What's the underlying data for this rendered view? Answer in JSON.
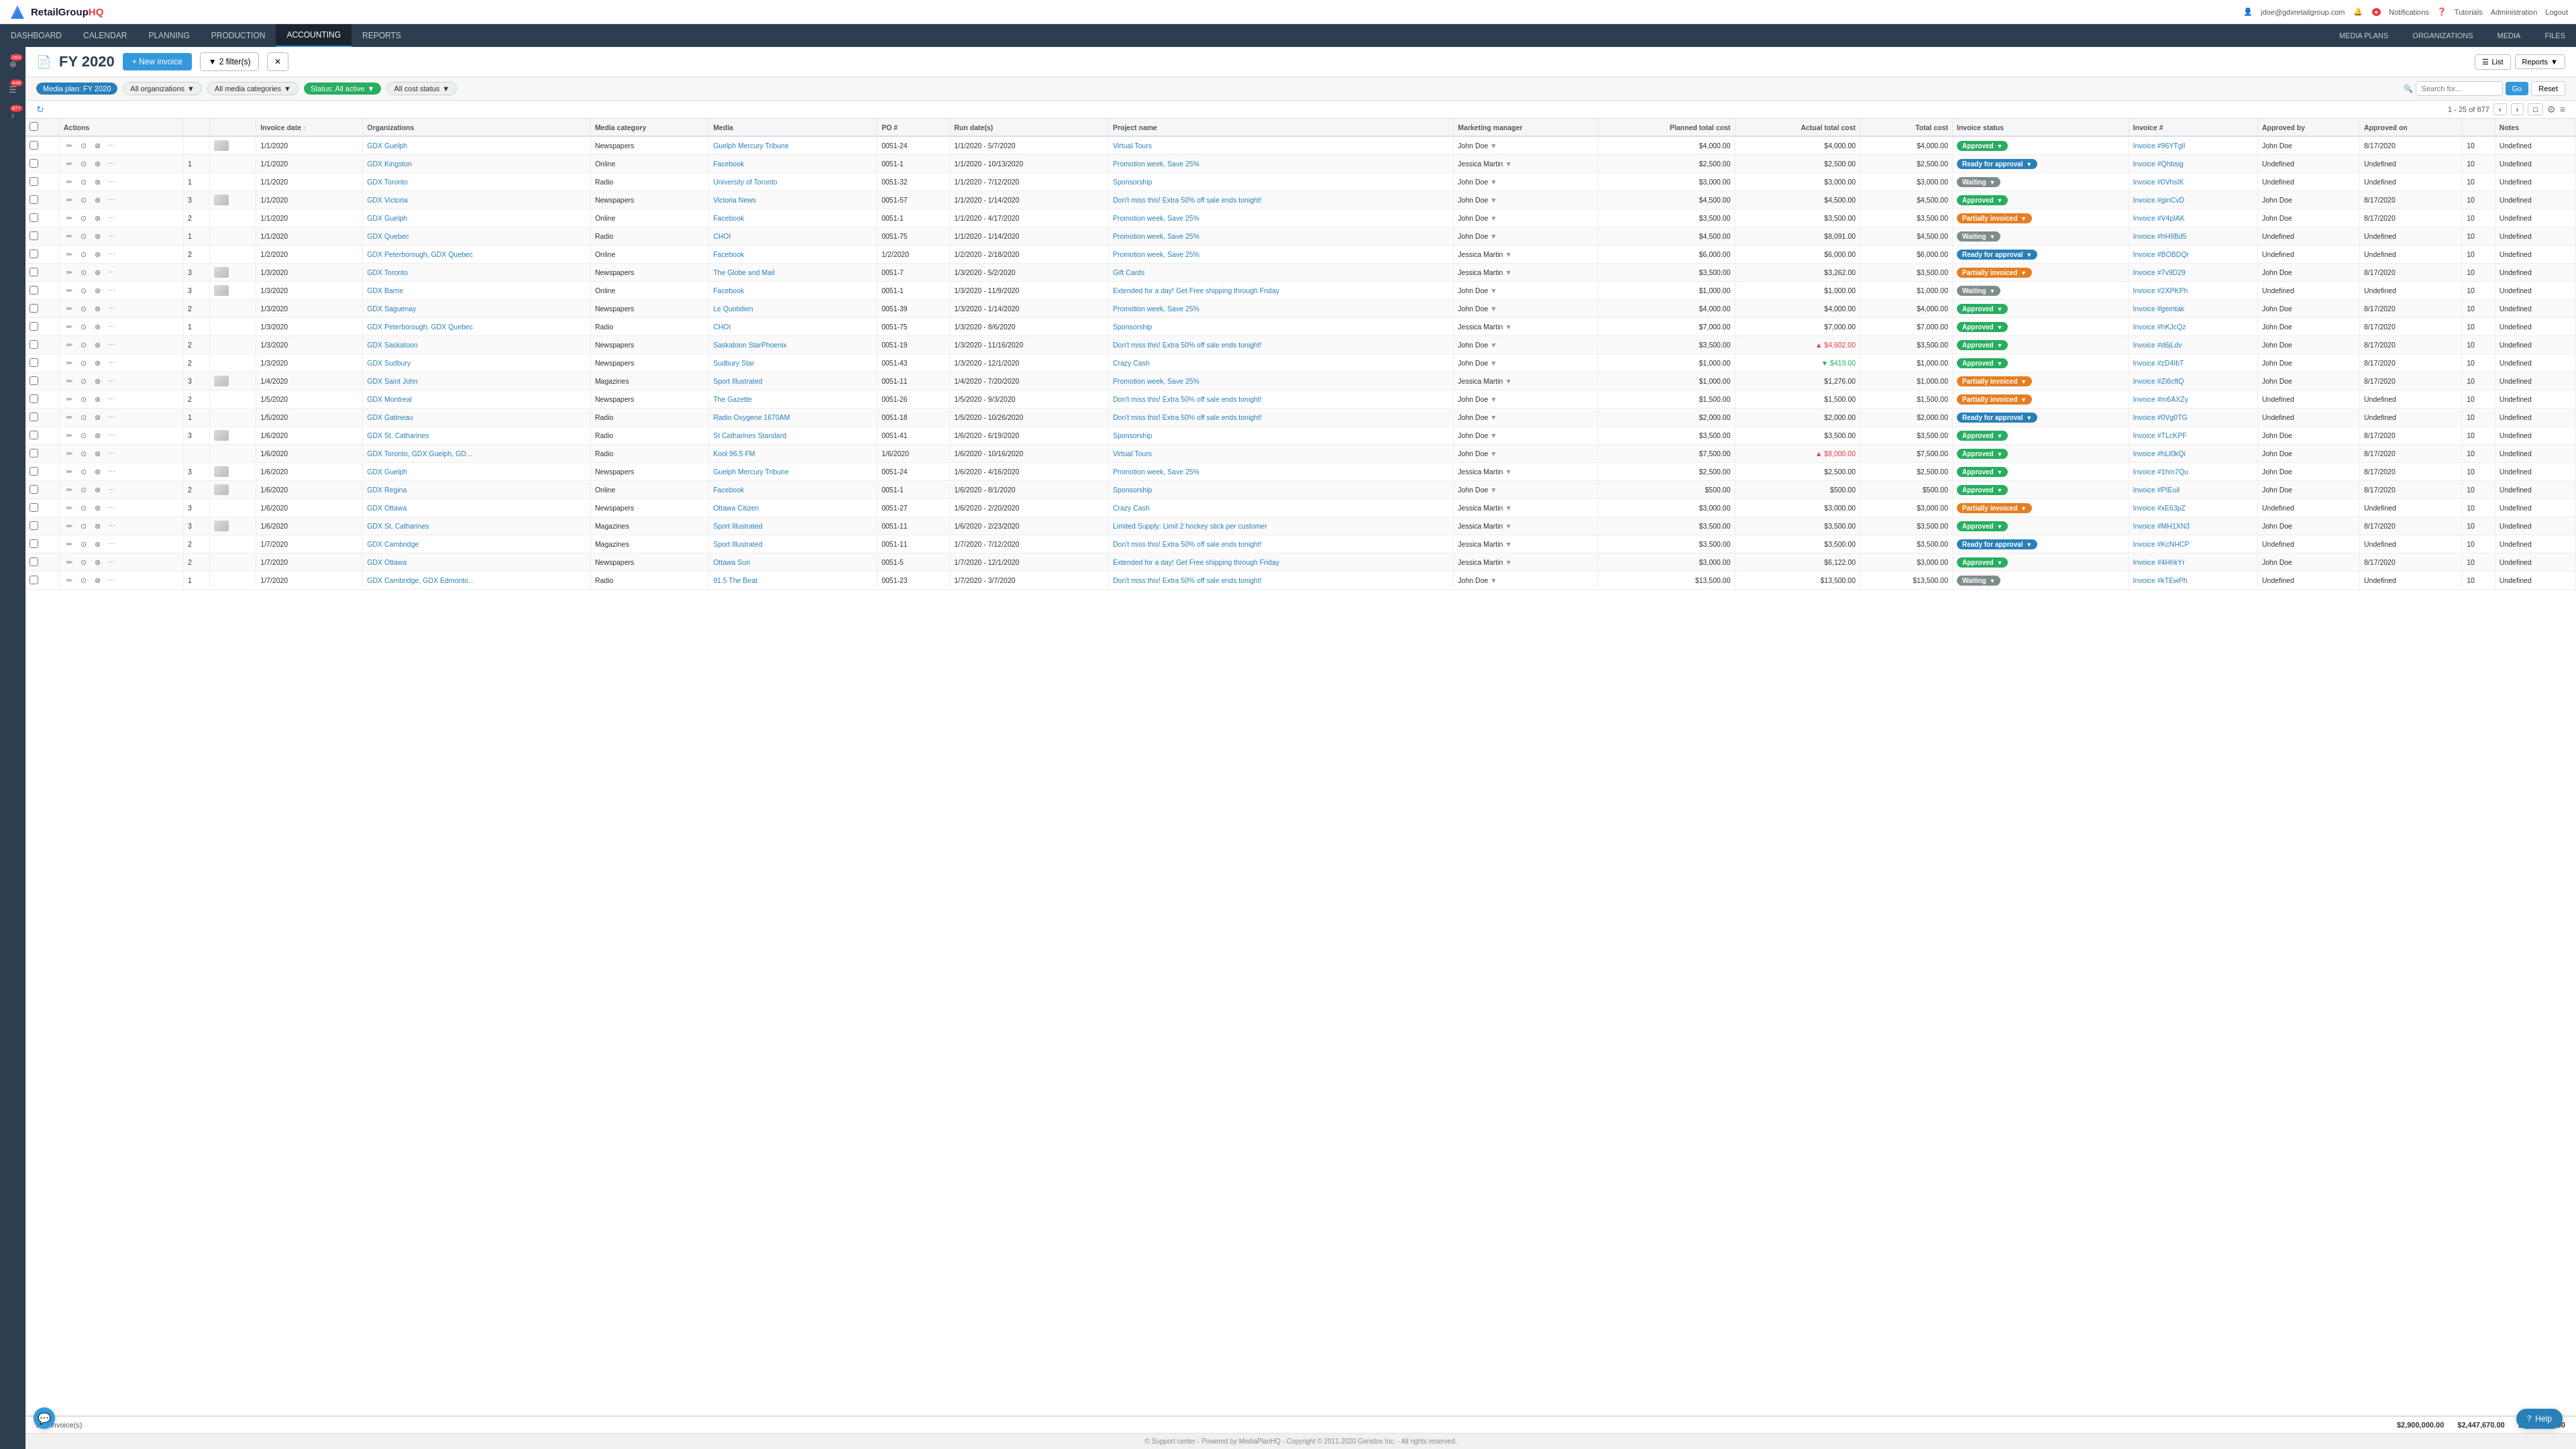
{
  "topNav": {
    "logo": "RetailGroup",
    "logoHQ": "HQ",
    "userEmail": "jdoe@gdxretailgroup.com",
    "notifications": "Notifications",
    "tutorials": "Tutorials",
    "administration": "Administration",
    "logout": "Logout"
  },
  "mainNav": {
    "items": [
      {
        "label": "DASHBOARD",
        "active": false
      },
      {
        "label": "CALENDAR",
        "active": false
      },
      {
        "label": "PLANNING",
        "active": false
      },
      {
        "label": "PRODUCTION",
        "active": false
      },
      {
        "label": "ACCOUNTING",
        "active": true
      },
      {
        "label": "REPORTS",
        "active": false
      }
    ],
    "rightItems": [
      {
        "label": "MEDIA PLANS"
      },
      {
        "label": "ORGANIZATIONS"
      },
      {
        "label": "MEDIA"
      },
      {
        "label": "FILES"
      }
    ]
  },
  "sidebar": {
    "items": [
      {
        "icon": "⊕",
        "badge": "264"
      },
      {
        "icon": "☰",
        "badge": "448"
      },
      {
        "icon": "♪",
        "badge": "877"
      }
    ]
  },
  "pageHeader": {
    "icon": "📋",
    "title": "FY 2020",
    "newInvoiceLabel": "+ New invoice",
    "filtersLabel": "2 filter(s)",
    "cancelIcon": "✕"
  },
  "filterBar": {
    "mediaplan": "Media plan: FY 2020",
    "organizations": "All organizations",
    "mediaCategories": "All media categories",
    "status": "Status: All active",
    "costStatus": "All cost status",
    "searchPlaceholder": "Search for...",
    "goLabel": "Go",
    "resetLabel": "Reset"
  },
  "toolbar": {
    "refreshIcon": "↻",
    "paginationInfo": "1 - 25 of 877",
    "listLabel": "List",
    "reportsLabel": "Reports",
    "settingsIcon": "⚙",
    "collapseIcon": "≡"
  },
  "tableHeaders": [
    {
      "label": "",
      "key": "check"
    },
    {
      "label": "",
      "key": "actions"
    },
    {
      "label": "",
      "key": "num"
    },
    {
      "label": "",
      "key": "thumb"
    },
    {
      "label": "Invoice date",
      "key": "date",
      "sortable": true
    },
    {
      "label": "Organizations",
      "key": "org",
      "sortable": false
    },
    {
      "label": "Media category",
      "key": "mediacat"
    },
    {
      "label": "Media",
      "key": "media"
    },
    {
      "label": "PO #",
      "key": "po"
    },
    {
      "label": "Run date(s)",
      "key": "run"
    },
    {
      "label": "Project name",
      "key": "project"
    },
    {
      "label": "Marketing manager",
      "key": "manager"
    },
    {
      "label": "Planned total cost",
      "key": "planned"
    },
    {
      "label": "Actual total cost",
      "key": "actual"
    },
    {
      "label": "Total cost",
      "key": "total"
    },
    {
      "label": "Invoice status",
      "key": "status"
    },
    {
      "label": "Invoice #",
      "key": "invoice"
    },
    {
      "label": "Approved by",
      "key": "appby"
    },
    {
      "label": "Approved on",
      "key": "appon"
    },
    {
      "label": "",
      "key": "n"
    },
    {
      "label": "Notes",
      "key": "notes"
    }
  ],
  "rows": [
    {
      "date": "1/1/2020",
      "org": "GDX Guelph",
      "mediacat": "Newspapers",
      "media": "Guelph Mercury Tribune",
      "po": "0051-24",
      "run": "1/1/2020 - 5/7/2020",
      "project": "Virtual Tours",
      "manager": "John Doe",
      "planned": "$4,000.00",
      "actual": "$4,000.00",
      "total": "$4,000.00",
      "status": "Approved",
      "statusClass": "status-approved",
      "invoice": "Invoice #96YTgll",
      "appby": "John Doe",
      "appon": "8/17/2020",
      "n": "10",
      "notes": "Undefined",
      "num": "",
      "thumb": "img"
    },
    {
      "date": "1/1/2020",
      "org": "GDX Kingston",
      "mediacat": "Online",
      "media": "Facebook",
      "po": "0051-1",
      "run": "1/1/2020 - 10/13/2020",
      "project": "Promotion week, Save 25%",
      "manager": "Jessica Martin",
      "planned": "$2,500.00",
      "actual": "$2,500.00",
      "total": "$2,500.00",
      "status": "Ready for approval",
      "statusClass": "status-ready",
      "invoice": "Invoice #Qhbsig",
      "appby": "Undefined",
      "appon": "Undefined",
      "n": "10",
      "notes": "Undefined",
      "num": "1",
      "thumb": ""
    },
    {
      "date": "1/1/2020",
      "org": "GDX Toronto",
      "mediacat": "Radio",
      "media": "University of Toronto",
      "po": "0051-32",
      "run": "1/1/2020 - 7/12/2020",
      "project": "Sponsorship",
      "manager": "John Doe",
      "planned": "$3,000.00",
      "actual": "$3,000.00",
      "total": "$3,000.00",
      "status": "Waiting",
      "statusClass": "status-waiting",
      "invoice": "Invoice #0VhsIK",
      "appby": "Undefined",
      "appon": "Undefined",
      "n": "10",
      "notes": "Undefined",
      "num": "1",
      "thumb": ""
    },
    {
      "date": "1/1/2020",
      "org": "GDX Victoria",
      "mediacat": "Newspapers",
      "media": "Victoria News",
      "po": "0051-57",
      "run": "1/1/2020 - 1/14/2020",
      "project": "Don't miss this! Extra 50% off sale ends tonight!",
      "manager": "John Doe",
      "planned": "$4,500.00",
      "actual": "$4,500.00",
      "total": "$4,500.00",
      "status": "Approved",
      "statusClass": "status-approved",
      "invoice": "Invoice #ginCvD",
      "appby": "John Doe",
      "appon": "8/17/2020",
      "n": "10",
      "notes": "Undefined",
      "num": "3",
      "thumb": "img"
    },
    {
      "date": "1/1/2020",
      "org": "GDX Guelph",
      "mediacat": "Online",
      "media": "Facebook",
      "po": "0051-1",
      "run": "1/1/2020 - 4/17/2020",
      "project": "Promotion week, Save 25%",
      "manager": "John Doe",
      "planned": "$3,500.00",
      "actual": "$3,500.00",
      "total": "$3,500.00",
      "status": "Partially invoiced",
      "statusClass": "status-partial",
      "invoice": "Invoice #V4plAK",
      "appby": "John Doe",
      "appon": "8/17/2020",
      "n": "10",
      "notes": "Undefined",
      "num": "2",
      "thumb": ""
    },
    {
      "date": "1/1/2020",
      "org": "GDX Quebec",
      "mediacat": "Radio",
      "media": "CHOI",
      "po": "0051-75",
      "run": "1/1/2020 - 1/14/2020",
      "project": "Promotion week, Save 25%",
      "manager": "John Doe",
      "planned": "$4,500.00",
      "actual": "$8,091.00",
      "total": "$4,500.00",
      "status": "Waiting",
      "statusClass": "status-waiting",
      "invoice": "Invoice #hH9Bd5",
      "appby": "Undefined",
      "appon": "Undefined",
      "n": "10",
      "notes": "Undefined",
      "num": "1",
      "thumb": ""
    },
    {
      "date": "1/2/2020",
      "org": "GDX Peterborough, GDX Quebec",
      "mediacat": "Online",
      "media": "Facebook",
      "po": "1/2/2020",
      "run": "1/2/2020 - 2/18/2020",
      "project": "Promotion week, Save 25%",
      "manager": "Jessica Martin",
      "planned": "$6,000.00",
      "actual": "$6,000.00",
      "total": "$6,000.00",
      "status": "Ready for approval",
      "statusClass": "status-ready",
      "invoice": "Invoice #BOBDQr",
      "appby": "Undefined",
      "appon": "Undefined",
      "n": "10",
      "notes": "Undefined",
      "num": "2",
      "thumb": ""
    },
    {
      "date": "1/3/2020",
      "org": "GDX Toronto",
      "mediacat": "Newspapers",
      "media": "The Globe and Mail",
      "po": "0051-7",
      "run": "1/3/2020 - 5/2/2020",
      "project": "Gift Cards",
      "manager": "Jessica Martin",
      "planned": "$3,500.00",
      "actual": "$3,262.00",
      "total": "$3,500.00",
      "status": "Partially invoiced",
      "statusClass": "status-partial",
      "invoice": "Invoice #7v9D29",
      "appby": "John Doe",
      "appon": "8/17/2020",
      "n": "10",
      "notes": "Undefined",
      "num": "3",
      "thumb": "img"
    },
    {
      "date": "1/3/2020",
      "org": "GDX Barrie",
      "mediacat": "Online",
      "media": "Facebook",
      "po": "0051-1",
      "run": "1/3/2020 - 11/9/2020",
      "project": "Extended for a day! Get Free shipping through Friday",
      "manager": "John Doe",
      "planned": "$1,000.00",
      "actual": "$1,000.00",
      "total": "$1,000.00",
      "status": "Waiting",
      "statusClass": "status-waiting",
      "invoice": "Invoice #2XPKPh",
      "appby": "Undefined",
      "appon": "Undefined",
      "n": "10",
      "notes": "Undefined",
      "num": "3",
      "thumb": "img"
    },
    {
      "date": "1/3/2020",
      "org": "GDX Saguenay",
      "mediacat": "Newspapers",
      "media": "Le Quotidien",
      "po": "0051-39",
      "run": "1/3/2020 - 1/14/2020",
      "project": "Promotion week, Save 25%",
      "manager": "John Doe",
      "planned": "$4,000.00",
      "actual": "$4,000.00",
      "total": "$4,000.00",
      "status": "Approved",
      "statusClass": "status-approved",
      "invoice": "Invoice #gemtak",
      "appby": "John Doe",
      "appon": "8/17/2020",
      "n": "10",
      "notes": "Undefined",
      "num": "2",
      "thumb": ""
    },
    {
      "date": "1/3/2020",
      "org": "GDX Peterborough, GDX Quebec",
      "mediacat": "Radio",
      "media": "CHOI",
      "po": "0051-75",
      "run": "1/3/2020 - 8/6/2020",
      "project": "Sponsorship",
      "manager": "Jessica Martin",
      "planned": "$7,000.00",
      "actual": "$7,000.00",
      "total": "$7,000.00",
      "status": "Approved",
      "statusClass": "status-approved",
      "invoice": "Invoice #hKJcQz",
      "appby": "John Doe",
      "appon": "8/17/2020",
      "n": "10",
      "notes": "Undefined",
      "num": "1",
      "thumb": ""
    },
    {
      "date": "1/3/2020",
      "org": "GDX Saskatoon",
      "mediacat": "Newspapers",
      "media": "Saskatoon StarPhoenix",
      "po": "0051-19",
      "run": "1/3/2020 - 11/16/2020",
      "project": "Don't miss this! Extra 50% off sale ends tonight!",
      "manager": "John Doe",
      "planned": "$3,500.00",
      "actual": "$4,602.00",
      "total": "$3,500.00",
      "status": "Approved",
      "statusClass": "status-approved",
      "invoice": "Invoice #d6jLdv",
      "appby": "John Doe",
      "appon": "8/17/2020",
      "n": "10",
      "notes": "Undefined",
      "num": "2",
      "thumb": "",
      "actualRed": true
    },
    {
      "date": "1/3/2020",
      "org": "GDX Sudbury",
      "mediacat": "Newspapers",
      "media": "Sudbury Star",
      "po": "0051-43",
      "run": "1/3/2020 - 12/1/2020",
      "project": "Crazy Cash",
      "manager": "John Doe",
      "planned": "$1,000.00",
      "actual": "$419.00",
      "total": "$1,000.00",
      "status": "Approved",
      "statusClass": "status-approved",
      "invoice": "Invoice #zD4IbT",
      "appby": "John Doe",
      "appon": "8/17/2020",
      "n": "10",
      "notes": "Undefined",
      "num": "2",
      "thumb": "",
      "actualGreen": true
    },
    {
      "date": "1/4/2020",
      "org": "GDX Saint John",
      "mediacat": "Magazines",
      "media": "Sport Illustrated",
      "po": "0051-11",
      "run": "1/4/2020 - 7/20/2020",
      "project": "Promotion week, Save 25%",
      "manager": "Jessica Martin",
      "planned": "$1,000.00",
      "actual": "$1,276.00",
      "total": "$1,000.00",
      "status": "Partially invoiced",
      "statusClass": "status-partial",
      "invoice": "Invoice #Zi6cftQ",
      "appby": "John Doe",
      "appon": "8/17/2020",
      "n": "10",
      "notes": "Undefined",
      "num": "3",
      "thumb": "img"
    },
    {
      "date": "1/5/2020",
      "org": "GDX Montreal",
      "mediacat": "Newspapers",
      "media": "The Gazette",
      "po": "0051-26",
      "run": "1/5/2020 - 9/3/2020",
      "project": "Don't miss this! Extra 50% off sale ends tonight!",
      "manager": "John Doe",
      "planned": "$1,500.00",
      "actual": "$1,500.00",
      "total": "$1,500.00",
      "status": "Partially invoiced",
      "statusClass": "status-partial",
      "invoice": "Invoice #m6AXZy",
      "appby": "Undefined",
      "appon": "Undefined",
      "n": "10",
      "notes": "Undefined",
      "num": "2",
      "thumb": ""
    },
    {
      "date": "1/5/2020",
      "org": "GDX Gatineau",
      "mediacat": "Radio",
      "media": "Radio Oxygene 1670AM",
      "po": "0051-18",
      "run": "1/5/2020 - 10/26/2020",
      "project": "Don't miss this! Extra 50% off sale ends tonight!",
      "manager": "John Doe",
      "planned": "$2,000.00",
      "actual": "$2,000.00",
      "total": "$2,000.00",
      "status": "Ready for approval",
      "statusClass": "status-ready",
      "invoice": "Invoice #0Vg0TG",
      "appby": "Undefined",
      "appon": "Undefined",
      "n": "10",
      "notes": "Undefined",
      "num": "1",
      "thumb": ""
    },
    {
      "date": "1/6/2020",
      "org": "GDX St. Catharines",
      "mediacat": "Radio",
      "media": "St Catharines Standard",
      "po": "0051-41",
      "run": "1/6/2020 - 6/19/2020",
      "project": "Sponsorship",
      "manager": "John Doe",
      "planned": "$3,500.00",
      "actual": "$3,500.00",
      "total": "$3,500.00",
      "status": "Approved",
      "statusClass": "status-approved",
      "invoice": "Invoice #TLcKPF",
      "appby": "John Doe",
      "appon": "8/17/2020",
      "n": "10",
      "notes": "Undefined",
      "num": "3",
      "thumb": "img"
    },
    {
      "date": "1/6/2020",
      "org": "GDX Toronto, GDX Guelph, GD...",
      "mediacat": "Radio",
      "media": "Kool 96.5 FM",
      "po": "1/6/2020",
      "run": "1/6/2020 - 10/16/2020",
      "project": "Virtual Tours",
      "manager": "John Doe",
      "planned": "$7,500.00",
      "actual": "$8,000.00",
      "total": "$7,500.00",
      "status": "Approved",
      "statusClass": "status-approved",
      "invoice": "Invoice #hLI0kQi",
      "appby": "John Doe",
      "appon": "8/17/2020",
      "n": "10",
      "notes": "Undefined",
      "num": "",
      "thumb": "",
      "actualRed": true
    },
    {
      "date": "1/6/2020",
      "org": "GDX Guelph",
      "mediacat": "Newspapers",
      "media": "Guelph Mercury Tribune",
      "po": "0051-24",
      "run": "1/6/2020 - 4/16/2020",
      "project": "Promotion week, Save 25%",
      "manager": "Jessica Martin",
      "planned": "$2,500.00",
      "actual": "$2,500.00",
      "total": "$2,500.00",
      "status": "Approved",
      "statusClass": "status-approved",
      "invoice": "Invoice #1hm7Qu",
      "appby": "John Doe",
      "appon": "8/17/2020",
      "n": "10",
      "notes": "Undefined",
      "num": "3",
      "thumb": "img"
    },
    {
      "date": "1/6/2020",
      "org": "GDX Regina",
      "mediacat": "Online",
      "media": "Facebook",
      "po": "0051-1",
      "run": "1/6/2020 - 8/1/2020",
      "project": "Sponsorship",
      "manager": "John Doe",
      "planned": "$500.00",
      "actual": "$500.00",
      "total": "$500.00",
      "status": "Approved",
      "statusClass": "status-approved",
      "invoice": "Invoice #PIEuil",
      "appby": "John Doe",
      "appon": "8/17/2020",
      "n": "10",
      "notes": "Undefined",
      "num": "2",
      "thumb": "img"
    },
    {
      "date": "1/6/2020",
      "org": "GDX Ottawa",
      "mediacat": "Newspapers",
      "media": "Ottawa Citizen",
      "po": "0051-27",
      "run": "1/6/2020 - 2/20/2020",
      "project": "Crazy Cash",
      "manager": "Jessica Martin",
      "planned": "$3,000.00",
      "actual": "$3,000.00",
      "total": "$3,000.00",
      "status": "Partially invoiced",
      "statusClass": "status-partial",
      "invoice": "Invoice #xE63pZ",
      "appby": "Undefined",
      "appon": "Undefined",
      "n": "10",
      "notes": "Undefined",
      "num": "3",
      "thumb": ""
    },
    {
      "date": "1/6/2020",
      "org": "GDX St. Catharines",
      "mediacat": "Magazines",
      "media": "Sport Illustrated",
      "po": "0051-11",
      "run": "1/6/2020 - 2/23/2020",
      "project": "Limited Supply: Limit 2 hockey stick per customer",
      "manager": "Jessica Martin",
      "planned": "$3,500.00",
      "actual": "$3,500.00",
      "total": "$3,500.00",
      "status": "Approved",
      "statusClass": "status-approved",
      "invoice": "Invoice #MH1XN3",
      "appby": "John Doe",
      "appon": "8/17/2020",
      "n": "10",
      "notes": "Undefined",
      "num": "3",
      "thumb": "img"
    },
    {
      "date": "1/7/2020",
      "org": "GDX Cambridge",
      "mediacat": "Magazines",
      "media": "Sport Illustrated",
      "po": "0051-11",
      "run": "1/7/2020 - 7/12/2020",
      "project": "Don't miss this! Extra 50% off sale ends tonight!",
      "manager": "Jessica Martin",
      "planned": "$3,500.00",
      "actual": "$3,500.00",
      "total": "$3,500.00",
      "status": "Ready for approval",
      "statusClass": "status-ready",
      "invoice": "Invoice #KcNHCP",
      "appby": "Undefined",
      "appon": "Undefined",
      "n": "10",
      "notes": "Undefined",
      "num": "2",
      "thumb": ""
    },
    {
      "date": "1/7/2020",
      "org": "GDX Ottawa",
      "mediacat": "Newspapers",
      "media": "Ottawa Sun",
      "po": "0051-5",
      "run": "1/7/2020 - 12/1/2020",
      "project": "Extended for a day! Get Free shipping through Friday",
      "manager": "Jessica Martin",
      "planned": "$3,000.00",
      "actual": "$6,122.00",
      "total": "$3,000.00",
      "status": "Approved",
      "statusClass": "status-approved",
      "invoice": "Invoice #4HhkYr",
      "appby": "John Doe",
      "appon": "8/17/2020",
      "n": "10",
      "notes": "Undefined",
      "num": "2",
      "thumb": ""
    },
    {
      "date": "1/7/2020",
      "org": "GDX Cambridge, GDX Edmonto...",
      "mediacat": "Radio",
      "media": "91.5 The Beat",
      "po": "0051-23",
      "run": "1/7/2020 - 3/7/2020",
      "project": "Don't miss this! Extra 50% off sale ends tonight!",
      "manager": "John Doe",
      "planned": "$13,500.00",
      "actual": "$13,500.00",
      "total": "$13,500.00",
      "status": "Waiting",
      "statusClass": "status-waiting",
      "invoice": "Invoice #kTEwPh",
      "appby": "Undefined",
      "appon": "Undefined",
      "n": "10",
      "notes": "Undefined",
      "num": "1",
      "thumb": ""
    }
  ],
  "footer": {
    "count": "877 invoice(s)",
    "planned": "$2,900,000.00",
    "actual": "$2,447,670.00",
    "total": "$2,918,152.00"
  },
  "bottomBar": {
    "text": "© Support center - Powered by MediaPlanHQ - Copyright © 2011-2020 Genidox Inc. - All rights reserved."
  },
  "help": {
    "label": "Help"
  }
}
